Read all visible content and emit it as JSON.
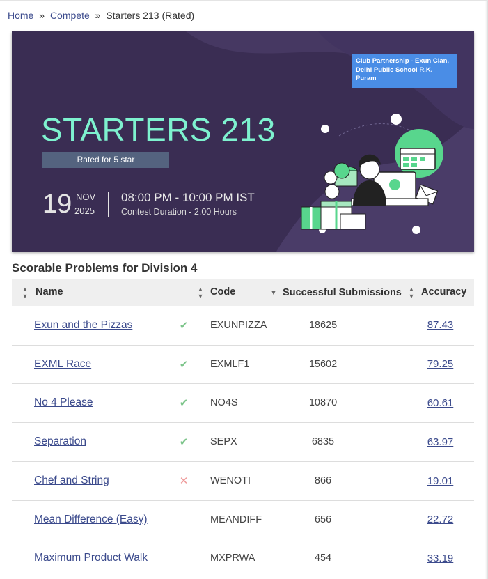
{
  "breadcrumb": {
    "home": "Home",
    "sep1": "»",
    "compete": "Compete",
    "sep2": "»",
    "current": "Starters 213 (Rated)"
  },
  "banner": {
    "partner": "Club Partnership - Exun Clan, Delhi Public School R.K. Puram",
    "title": "STARTERS 213",
    "rated": "Rated for 5 star",
    "day": "19",
    "month": "NOV",
    "year": "2025",
    "time": "08:00 PM - 10:00 PM IST",
    "duration": "Contest Duration - 2.00 Hours"
  },
  "section_title": "Scorable Problems for Division 4",
  "table": {
    "headers": {
      "name": "Name",
      "code": "Code",
      "submissions": "Successful Submissions",
      "accuracy": "Accuracy"
    },
    "rows": [
      {
        "name": "Exun and the Pizzas",
        "status": "solved",
        "code": "EXUNPIZZA",
        "submissions": "18625",
        "accuracy": "87.43"
      },
      {
        "name": "EXML Race",
        "status": "solved",
        "code": "EXMLF1",
        "submissions": "15602",
        "accuracy": "79.25"
      },
      {
        "name": "No 4 Please",
        "status": "solved",
        "code": "NO4S",
        "submissions": "10870",
        "accuracy": "60.61"
      },
      {
        "name": "Separation",
        "status": "solved",
        "code": "SEPX",
        "submissions": "6835",
        "accuracy": "63.97"
      },
      {
        "name": "Chef and String",
        "status": "wrong",
        "code": "WENOTI",
        "submissions": "866",
        "accuracy": "19.01"
      },
      {
        "name": "Mean Difference (Easy)",
        "status": "",
        "code": "MEANDIFF",
        "submissions": "656",
        "accuracy": "22.72"
      },
      {
        "name": "Maximum Product Walk",
        "status": "",
        "code": "MXPRWA",
        "submissions": "454",
        "accuracy": "33.19"
      }
    ]
  },
  "colors": {
    "banner_bg": "#3a2d53",
    "title_mint": "#7ef2cf",
    "link": "#3b4a8c",
    "solved": "#7cc48a",
    "wrong": "#ef9a9a",
    "partner_badge": "#4a8de6"
  },
  "icons": {
    "sort": "sort-arrows-icon",
    "sort_active": "sort-desc-icon",
    "solved": "check-icon",
    "wrong": "cross-icon"
  }
}
